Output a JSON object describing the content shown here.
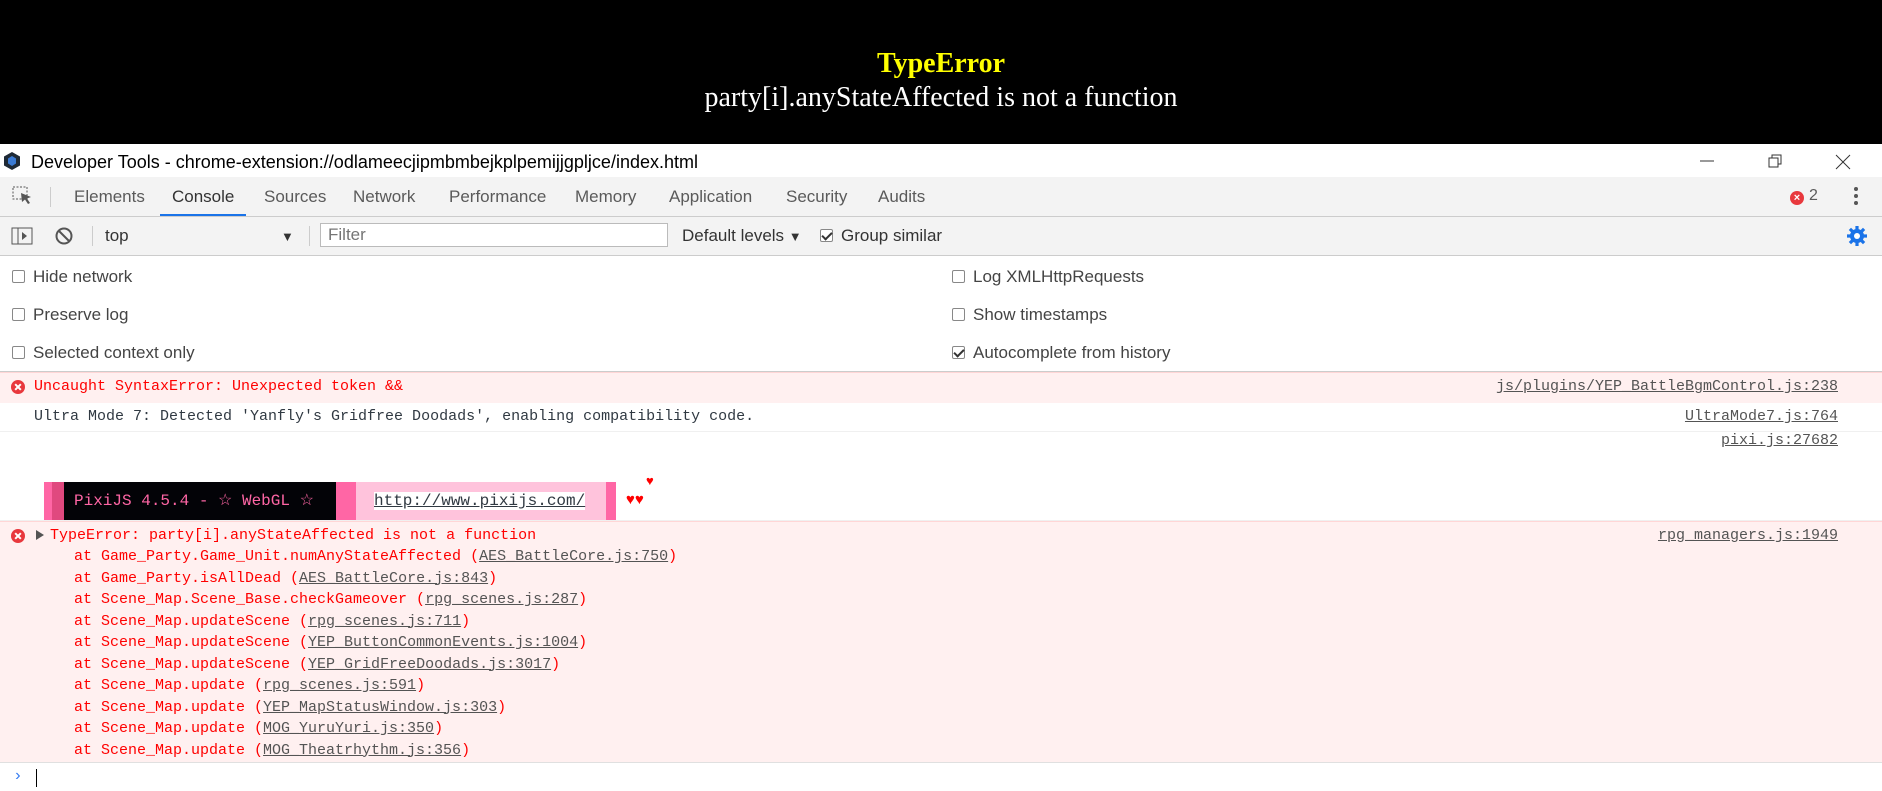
{
  "game": {
    "error_title": "TypeError",
    "error_message": "party[i].anyStateAffected is not a function"
  },
  "window": {
    "title": "Developer Tools - chrome-extension://odlameecjipmbmbejkplpemijjgpljce/index.html"
  },
  "tabs": [
    {
      "label": "Elements"
    },
    {
      "label": "Console"
    },
    {
      "label": "Sources"
    },
    {
      "label": "Network"
    },
    {
      "label": "Performance"
    },
    {
      "label": "Memory"
    },
    {
      "label": "Application"
    },
    {
      "label": "Security"
    },
    {
      "label": "Audits"
    }
  ],
  "error_count": "2",
  "toolbar": {
    "context": "top",
    "filter_placeholder": "Filter",
    "levels": "Default levels",
    "group_similar": "Group similar"
  },
  "settings": {
    "hide_network": "Hide network",
    "preserve_log": "Preserve log",
    "selected_context": "Selected context only",
    "log_xhr": "Log XMLHttpRequests",
    "show_timestamps": "Show timestamps",
    "autocomplete": "Autocomplete from history"
  },
  "messages": {
    "m1_text": "Uncaught SyntaxError: Unexpected token &&",
    "m1_src": "js/plugins/YEP_BattleBgmControl.js:238",
    "m2_text": "Ultra Mode 7: Detected 'Yanfly's Gridfree Doodads', enabling compatibility code.",
    "m2_src": "UltraMode7.js:764",
    "m3_src": "pixi.js:27682",
    "pixi_label": "PixiJS 4.5.4 - ☆ WebGL ☆",
    "pixi_url": "http://www.pixijs.com/",
    "hearts": "♥♥",
    "heart_single": "♥",
    "m4_text": "TypeError: party[i].anyStateAffected is not a function",
    "m4_src": "rpg_managers.js:1949"
  },
  "stack": [
    {
      "prefix": "at Game_Party.Game_Unit.numAnyStateAffected (",
      "link": "AES_BattleCore.js:750",
      "suffix": ")"
    },
    {
      "prefix": "at Game_Party.isAllDead (",
      "link": "AES_BattleCore.js:843",
      "suffix": ")"
    },
    {
      "prefix": "at Scene_Map.Scene_Base.checkGameover (",
      "link": "rpg_scenes.js:287",
      "suffix": ")"
    },
    {
      "prefix": "at Scene_Map.updateScene (",
      "link": "rpg_scenes.js:711",
      "suffix": ")"
    },
    {
      "prefix": "at Scene_Map.updateScene (",
      "link": "YEP_ButtonCommonEvents.js:1004",
      "suffix": ")"
    },
    {
      "prefix": "at Scene_Map.updateScene (",
      "link": "YEP_GridFreeDoodads.js:3017",
      "suffix": ")"
    },
    {
      "prefix": "at Scene_Map.update (",
      "link": "rpg_scenes.js:591",
      "suffix": ")"
    },
    {
      "prefix": "at Scene_Map.update (",
      "link": "YEP_MapStatusWindow.js:303",
      "suffix": ")"
    },
    {
      "prefix": "at Scene_Map.update (",
      "link": "MOG_YuruYuri.js:350",
      "suffix": ")"
    },
    {
      "prefix": "at Scene_Map.update (",
      "link": "MOG_Theatrhythm.js:356",
      "suffix": ")"
    }
  ]
}
